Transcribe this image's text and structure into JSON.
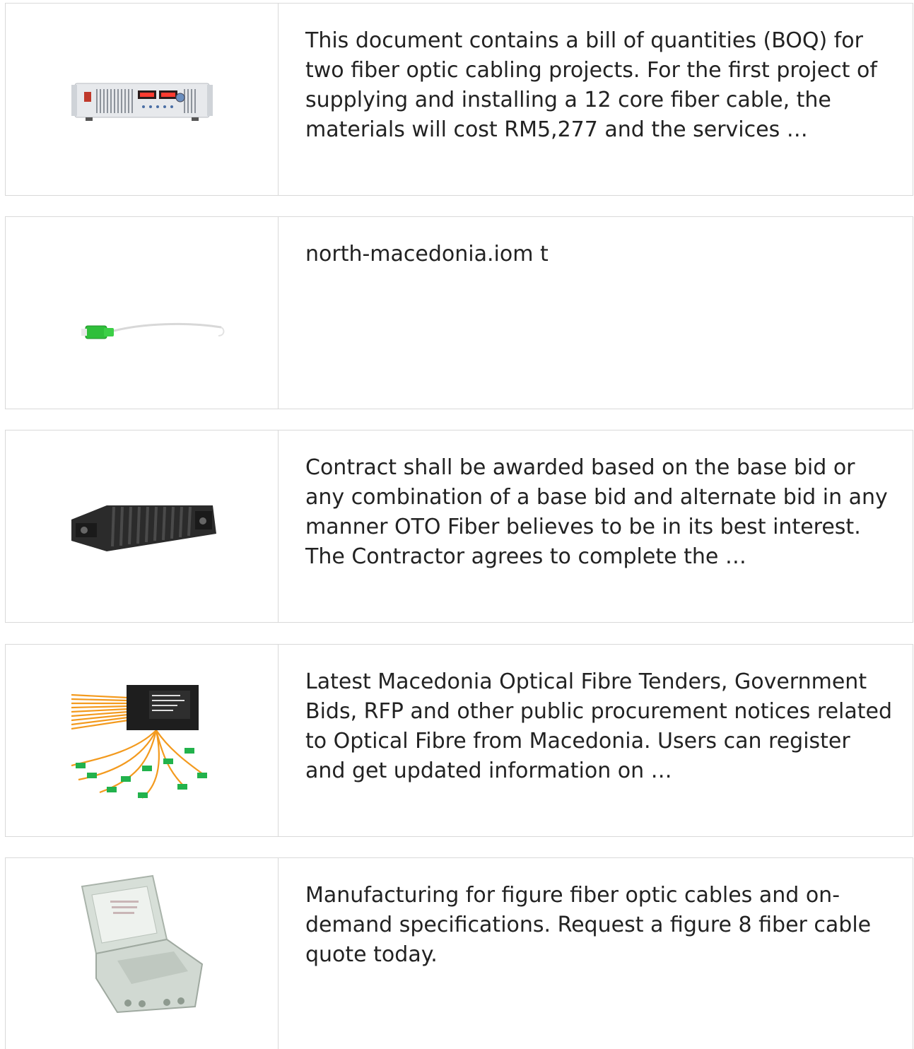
{
  "items": [
    {
      "image": "power-supply-unit",
      "description": "This document contains a bill of quantities (BOQ) for two fiber optic cabling projects. For the first project of supplying and installing a 12 core fiber cable, the materials will cost RM5,277 and the services …"
    },
    {
      "image": "sc-fiber-pigtail",
      "description": "north-macedonia.iom t"
    },
    {
      "image": "fiber-splice-closure",
      "description": "Contract shall be awarded based on the base bid or any combination of a base bid and alternate bid in any manner OTO Fiber believes to be in its best interest. The Contractor agrees to complete the …"
    },
    {
      "image": "plc-splitter-box",
      "description": "Latest Macedonia Optical Fibre Tenders, Government Bids, RFP and other public procurement notices related to Optical Fibre from Macedonia. Users can register and get updated information on …"
    },
    {
      "image": "fiber-distribution-box",
      "description": "Manufacturing for figure fiber optic cables and on-demand specifications. Request a figure 8 fiber cable quote today."
    }
  ]
}
